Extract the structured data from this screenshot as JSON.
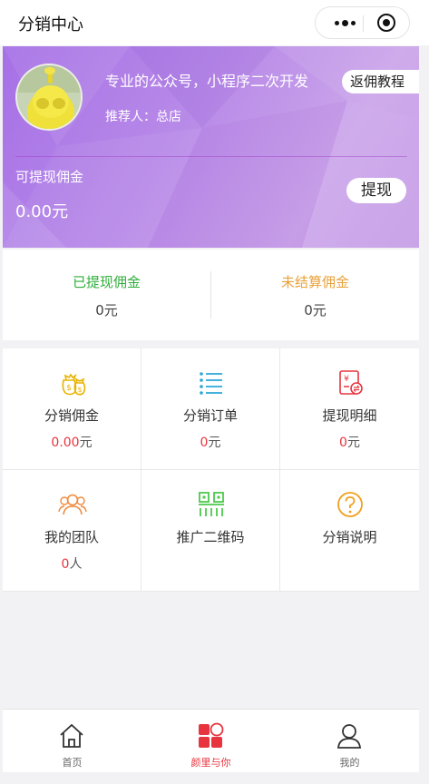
{
  "navbar": {
    "title": "分销中心",
    "more_icon": "more-dots-icon",
    "close_icon": "target-close-icon"
  },
  "banner": {
    "title": "专业的公众号，小程序二次开发",
    "tutorial_button": "返佣教程",
    "referrer": "推荐人：总店",
    "withdrawable_label": "可提现佣金",
    "withdrawable_amount": "0.00元",
    "withdraw_button": "提现",
    "colors": {
      "gradient_start": "#a670e6",
      "gradient_end": "#c49ae6"
    }
  },
  "stats": [
    {
      "label": "已提现佣金",
      "value": "0元",
      "color": "#2fae3a"
    },
    {
      "label": "未结算佣金",
      "value": "0元",
      "color": "#e8a13a"
    }
  ],
  "grid": [
    {
      "title": "分销佣金",
      "num": "0.00",
      "unit": "元",
      "icon": "money-bags-icon",
      "color": "#e8b400"
    },
    {
      "title": "分销订单",
      "num": "0",
      "unit": "元",
      "icon": "list-icon",
      "color": "#2aa7d8"
    },
    {
      "title": "提现明细",
      "num": "0",
      "unit": "元",
      "icon": "receipt-exchange-icon",
      "color": "#e8343f"
    },
    {
      "title": "我的团队",
      "num": "0",
      "unit": "人",
      "icon": "team-icon",
      "color": "#f08a3c"
    },
    {
      "title": "推广二维码",
      "icon": "qr-code-icon",
      "color": "#4cc94c"
    },
    {
      "title": "分销说明",
      "icon": "question-circle-icon",
      "color": "#f0a020"
    }
  ],
  "tabbar": [
    {
      "label": "首页",
      "icon": "home-icon",
      "active": false
    },
    {
      "label": "颜里与你",
      "icon": "category-blocks-icon",
      "active": true
    },
    {
      "label": "我的",
      "icon": "user-icon",
      "active": false
    }
  ],
  "accent_color": "#e8343f"
}
